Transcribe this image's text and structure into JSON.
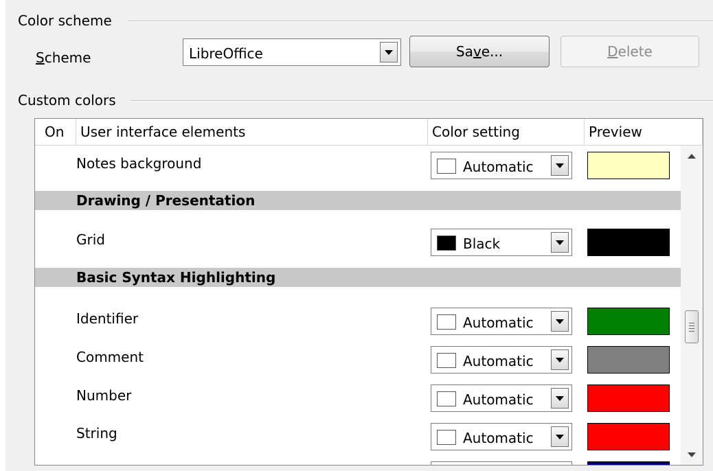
{
  "color_scheme": {
    "group_title": "Color scheme",
    "scheme_label_prefix": "",
    "scheme_label_underlined": "S",
    "scheme_label_rest": "cheme",
    "scheme_value": "LibreOffice",
    "save_prefix": "Sa",
    "save_underlined": "v",
    "save_rest": "e...",
    "delete_underlined": "D",
    "delete_rest": "elete"
  },
  "custom_colors": {
    "group_title": "Custom colors",
    "columns": [
      "On",
      "User interface elements",
      "Color setting",
      "Preview"
    ],
    "rows": [
      {
        "label": "Notes background",
        "setting": "Automatic",
        "swatch": "#ffffff",
        "preview": "#ffffc0"
      },
      {
        "section": "Drawing / Presentation"
      },
      {
        "label": "Grid",
        "setting": "Black",
        "swatch": "#000000",
        "preview": "#000000"
      },
      {
        "section": "Basic Syntax Highlighting"
      },
      {
        "label": "Identifier",
        "setting": "Automatic",
        "swatch": "#ffffff",
        "preview": "#008000"
      },
      {
        "label": "Comment",
        "setting": "Automatic",
        "swatch": "#ffffff",
        "preview": "#808080"
      },
      {
        "label": "Number",
        "setting": "Automatic",
        "swatch": "#ffffff",
        "preview": "#ff0000"
      },
      {
        "label": "String",
        "setting": "Automatic",
        "swatch": "#ffffff",
        "preview": "#ff0000"
      },
      {
        "label": "",
        "setting": "",
        "swatch": "#ffffff",
        "preview": "#000080"
      }
    ]
  }
}
